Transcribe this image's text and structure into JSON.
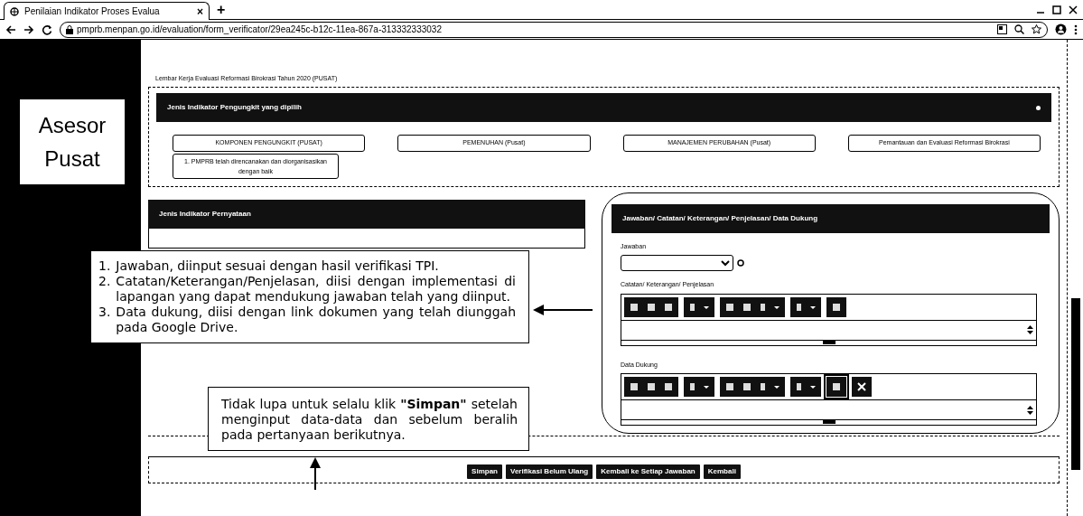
{
  "browser": {
    "tab": {
      "title": "Penilaian Indikator Proses Evalua",
      "close": "×"
    },
    "new_tab": "+",
    "url": "pmprb.menpan.go.id/evaluation/form_verificator/29ea245c-b12c-11ea-867a-313332333032"
  },
  "sidebar": {
    "label": "Asesor Pusat"
  },
  "page_title": "Lembar Kerja Evaluasi Reformasi Birokrasi Tahun 2020 (PUSAT)",
  "indicator_panel": {
    "title": "Jenis Indikator Pengungkit yang dipilih",
    "components": [
      "KOMPONEN PENGUNGKIT (PUSAT)",
      "PEMENUHAN (Pusat)",
      "MANAJEMEN PERUBAHAN (Pusat)",
      "Pemantauan dan Evaluasi Reformasi Birokrasi"
    ],
    "sub_items": [
      "1. PMPRB telah direncanakan dan diorganisasikan dengan baik"
    ]
  },
  "statement_panel": {
    "title": "Jenis Indikator Pernyataan"
  },
  "answer_panel": {
    "title": "Jawaban/ Catatan/ Keterangan/ Penjelasan/ Data Dukung",
    "answer_label": "Jawaban",
    "editors": [
      {
        "label": "Catatan/ Keterangan/ Penjelasan",
        "tool_groups": [
          [
            {
              "kind": "icon"
            },
            {
              "kind": "icon"
            },
            {
              "kind": "icon"
            }
          ],
          [
            {
              "kind": "dropdown"
            }
          ],
          [
            {
              "kind": "icon"
            },
            {
              "kind": "icon"
            },
            {
              "kind": "dropdown"
            }
          ],
          [
            {
              "kind": "dropdown"
            }
          ],
          [
            {
              "kind": "icon"
            }
          ]
        ]
      },
      {
        "label": "Data Dukung",
        "tool_groups": [
          [
            {
              "kind": "icon"
            },
            {
              "kind": "icon"
            },
            {
              "kind": "icon"
            }
          ],
          [
            {
              "kind": "dropdown"
            }
          ],
          [
            {
              "kind": "icon"
            },
            {
              "kind": "icon"
            },
            {
              "kind": "dropdown"
            }
          ],
          [
            {
              "kind": "dropdown"
            }
          ],
          [
            {
              "kind": "highlighted"
            }
          ],
          [
            {
              "kind": "close"
            }
          ]
        ]
      }
    ]
  },
  "callouts": [
    {
      "kind": "list",
      "items": [
        {
          "number": "1.",
          "text": "Jawaban, diinput sesuai dengan hasil verifikasi TPI."
        },
        {
          "number": "2.",
          "text": "Catatan/Keterangan/Penjelasan, diisi dengan implementasi di lapangan yang dapat mendukung jawaban telah yang diinput."
        },
        {
          "number": "3.",
          "text": "Data dukung, diisi dengan link dokumen yang telah diunggah pada Google Drive."
        }
      ]
    },
    {
      "kind": "note",
      "text": "Tidak lupa untuk selalu klik **\"Simpan\"** setelah menginput data-data dan sebelum beralih pada pertanyaan berikutnya."
    }
  ],
  "actions": [
    "Simpan",
    "Verifikasi Belum Ulang",
    "Kembali ke Setiap Jawaban",
    "Kembali"
  ]
}
